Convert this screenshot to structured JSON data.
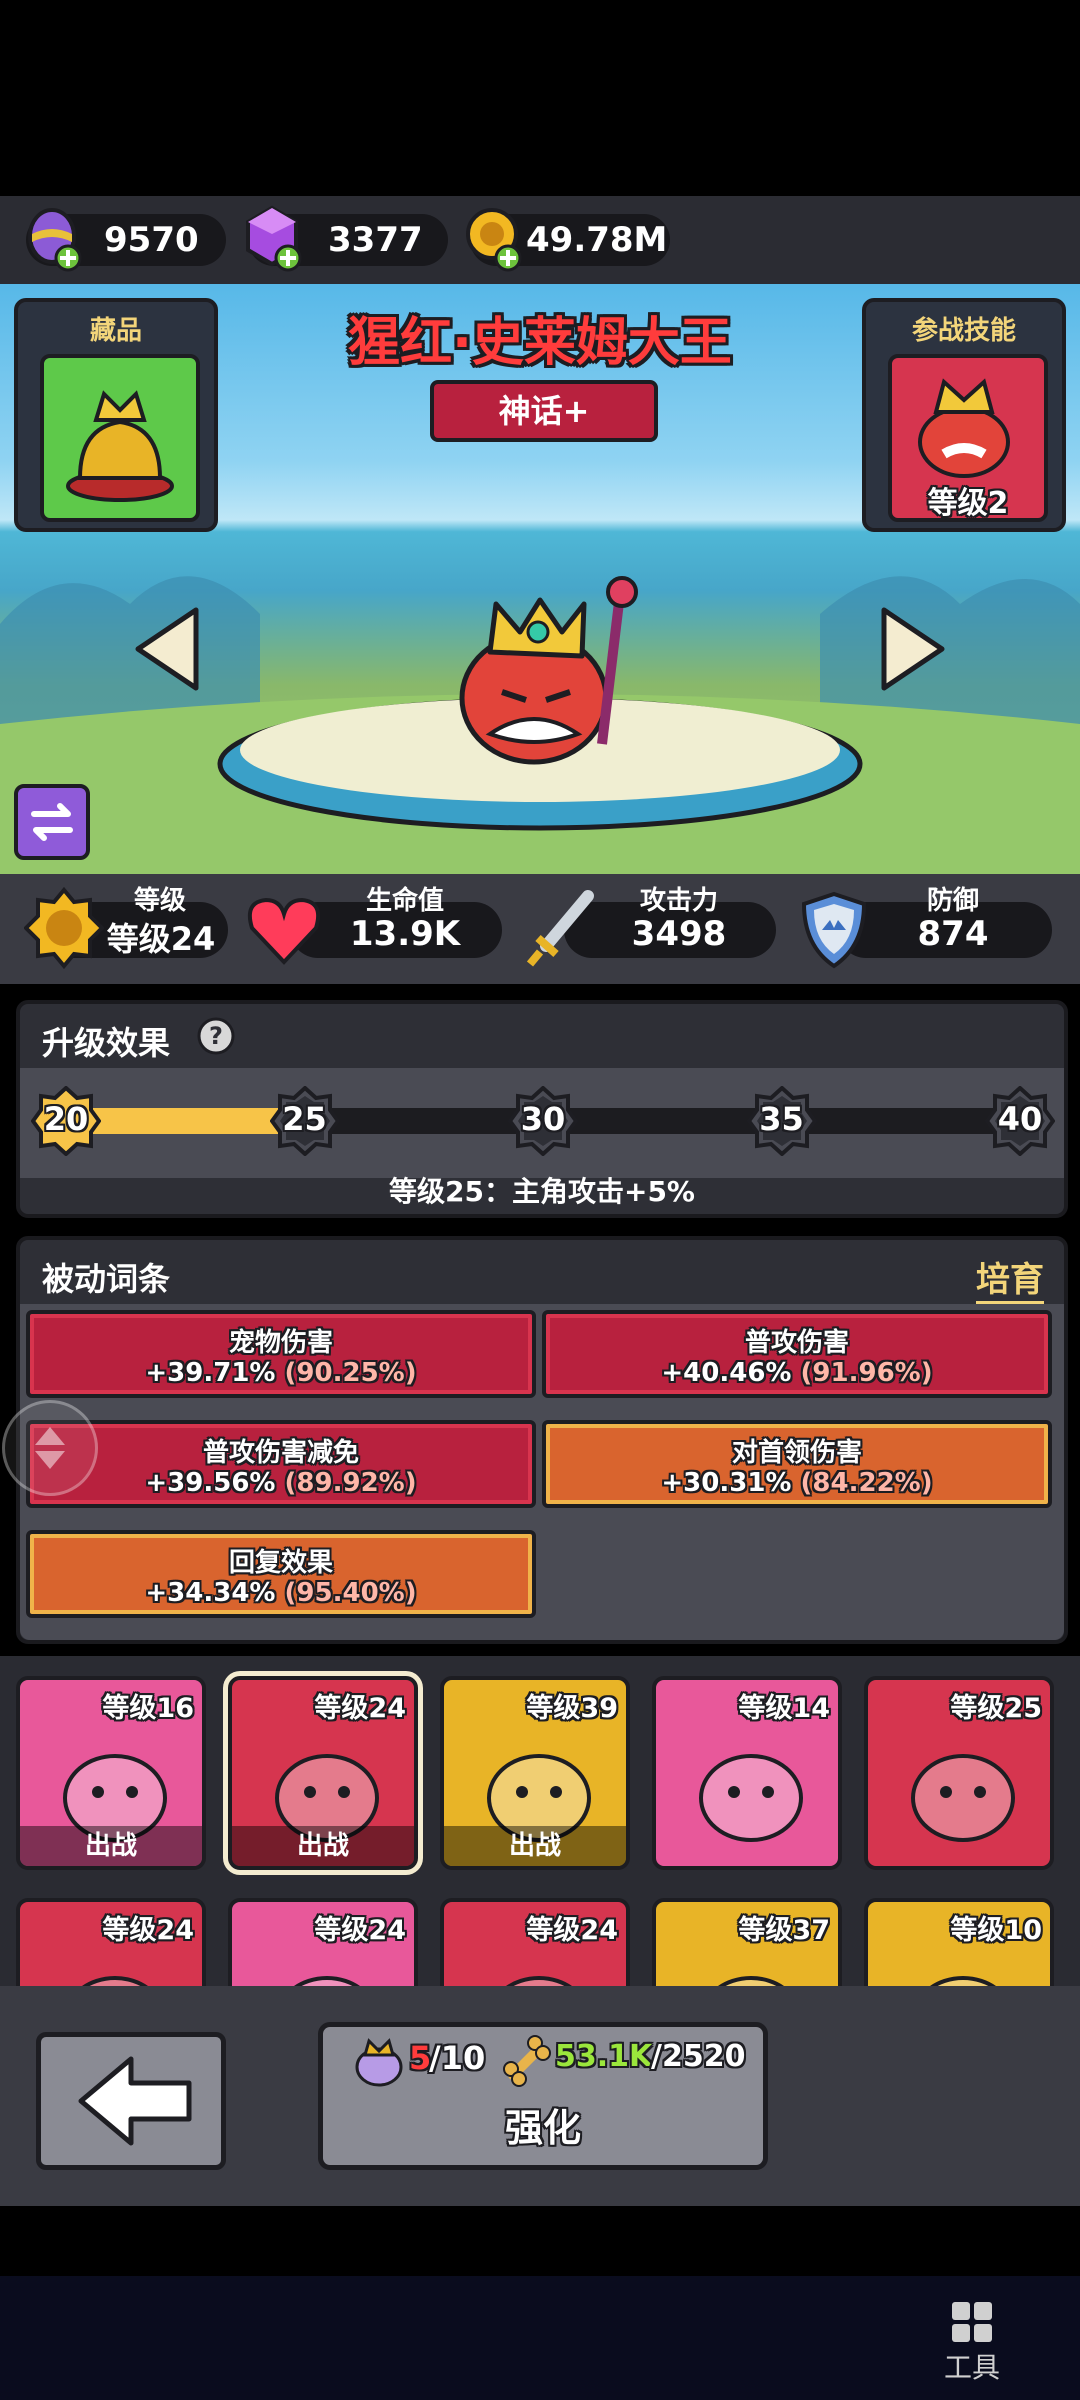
{
  "currencies": [
    {
      "icon": "purple-egg-icon",
      "value": "9570"
    },
    {
      "icon": "purple-gem-icon",
      "value": "3377"
    },
    {
      "icon": "gold-coin-icon",
      "value": "49.78M"
    }
  ],
  "hero": {
    "name": "猩红·史莱姆大王",
    "rarity": "神话+",
    "collection_label": "藏品",
    "skill_label": "参战技能",
    "skill_level": "等级2"
  },
  "stats": {
    "level_label": "等级",
    "level_value": "等级24",
    "hp_label": "生命值",
    "hp_value": "13.9K",
    "atk_label": "攻击力",
    "atk_value": "3498",
    "def_label": "防御",
    "def_value": "874"
  },
  "upgrade": {
    "title": "升级效果",
    "milestones": [
      "20",
      "25",
      "30",
      "35",
      "40"
    ],
    "progress": 0.25,
    "description": "等级25：主角攻击+5%"
  },
  "passive": {
    "title": "被动词条",
    "cultivate_label": "培育",
    "cards": [
      {
        "name": "宠物伤害",
        "value": "+39.71%",
        "pct": "(90.25%)",
        "tier": "red"
      },
      {
        "name": "普攻伤害",
        "value": "+40.46%",
        "pct": "(91.96%)",
        "tier": "red"
      },
      {
        "name": "普攻伤害减免",
        "value": "+39.56%",
        "pct": "(89.92%)",
        "tier": "red"
      },
      {
        "name": "对首领伤害",
        "value": "+30.31%",
        "pct": "(84.22%)",
        "tier": "orange"
      },
      {
        "name": "回复效果",
        "value": "+34.34%",
        "pct": "(95.40%)",
        "tier": "orange"
      }
    ]
  },
  "pets": [
    {
      "level": "等级16",
      "tag": "出战",
      "color": "#e8589a"
    },
    {
      "level": "等级24",
      "tag": "出战",
      "color": "#d6354f"
    },
    {
      "level": "等级39",
      "tag": "出战",
      "color": "#e8b427"
    },
    {
      "level": "等级14",
      "tag": "",
      "color": "#e8589a"
    },
    {
      "level": "等级25",
      "tag": "",
      "color": "#d6354f"
    },
    {
      "level": "等级24",
      "tag": "",
      "color": "#d6354f"
    },
    {
      "level": "等级24",
      "tag": "",
      "color": "#e8589a"
    },
    {
      "level": "等级24",
      "tag": "",
      "color": "#d6354f"
    },
    {
      "level": "等级37",
      "tag": "",
      "color": "#e8b427"
    },
    {
      "level": "等级10",
      "tag": "",
      "color": "#e8b427"
    }
  ],
  "bottom": {
    "cost1_current": "5",
    "cost1_total": "/10",
    "cost2_current": "53.1K",
    "cost2_total": "/2520",
    "upgrade_label": "强化"
  },
  "nav": {
    "tools_label": "工具"
  }
}
